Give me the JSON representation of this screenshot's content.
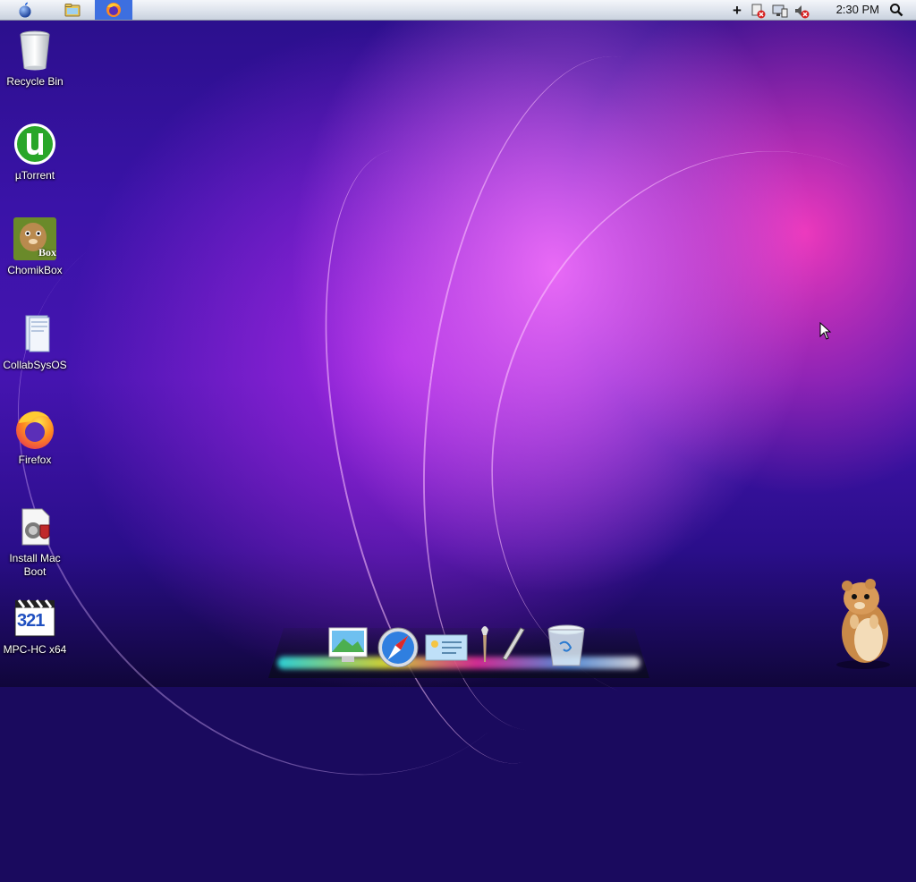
{
  "menubar": {
    "items": [
      {
        "name": "apple-menu",
        "icon": "apple-icon"
      },
      {
        "name": "file-manager",
        "icon": "folder-icon"
      },
      {
        "name": "firefox-task",
        "icon": "firefox-icon",
        "active": true
      }
    ],
    "tray": [
      "add-icon",
      "network-error-icon",
      "monitor-icon",
      "volume-muted-icon"
    ],
    "clock": "2:30 PM"
  },
  "desktop": {
    "icons": [
      {
        "label": "Recycle Bin",
        "icon": "recycle-bin-icon"
      },
      {
        "label": "µTorrent",
        "icon": "utorrent-icon"
      },
      {
        "label": "ChomikBox",
        "icon": "chomikbox-icon",
        "badge": "Box"
      },
      {
        "label": "CollabSysOS",
        "icon": "document-folder-icon"
      },
      {
        "label": "Firefox",
        "icon": "firefox-icon"
      },
      {
        "label": "Install Mac Boot",
        "icon": "installer-icon"
      },
      {
        "label": "MPC-HC x64",
        "icon": "mpc-hc-icon",
        "badge": "321"
      }
    ]
  },
  "dock": {
    "items": [
      "photo-viewer-icon",
      "safari-icon",
      "preview-icon",
      "brush-icon",
      "pen-icon",
      "trash-icon"
    ]
  },
  "colors": {
    "menubar": "#dde3ec",
    "active_task": "#3d6fe0",
    "wallpaper_base": "#3a13a8",
    "wallpaper_pink": "#ff3cbe"
  }
}
